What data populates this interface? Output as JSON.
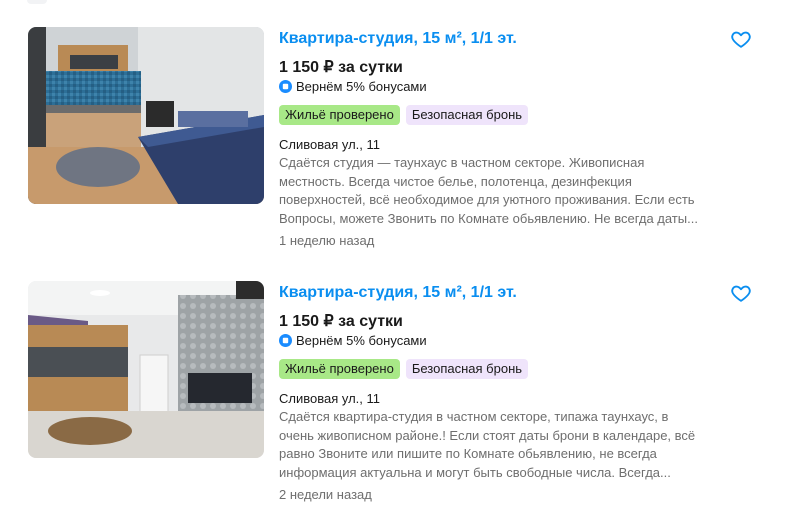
{
  "listings": [
    {
      "title": "Квартира-студия, 15 м², 1/1 эт.",
      "price": "1 150 ₽ за сутки",
      "bonus": "Вернём 5% бонусами",
      "badges": [
        "Жильё проверено",
        "Безопасная бронь"
      ],
      "address": "Сливовая ул., 11",
      "description_lines": [
        "Сдаётся студия — таунхаус в частном секторе. Живописная",
        "местность. Всегда чистое белье, полотенца, дезинфекция",
        "поверхностей, всё необходимое для уютного проживания. Если есть",
        "Вопросы, можете Звонить по Комнате обьявлению. Не всегда даты..."
      ],
      "date": "1 неделю назад"
    },
    {
      "title": "Квартира-студия, 15 м², 1/1 эт.",
      "price": "1 150 ₽ за сутки",
      "bonus": "Вернём 5% бонусами",
      "badges": [
        "Жильё проверено",
        "Безопасная бронь"
      ],
      "address": "Сливовая ул., 11",
      "description_lines": [
        "Сдаётся квартира-студия в частном секторе, типажа таунхаус, в",
        "очень живописном районе.! Если стоят даты брони в календаре, всё",
        "равно Звоните или пишите по Комнате обьявлению, не всегда",
        "информация актуальна и могут быть свободные числа. Всегда..."
      ],
      "date": "2 недели назад"
    }
  ],
  "icons": {
    "favorite": "heart-outline-icon",
    "bonus": "bonus-coin-icon"
  },
  "colors": {
    "title": "#0a8ef0",
    "badge_verified": "#a8e887",
    "badge_safe": "#efe4fb",
    "muted_text": "#6e6e6e",
    "bonus_icon": "#1a8cff"
  }
}
